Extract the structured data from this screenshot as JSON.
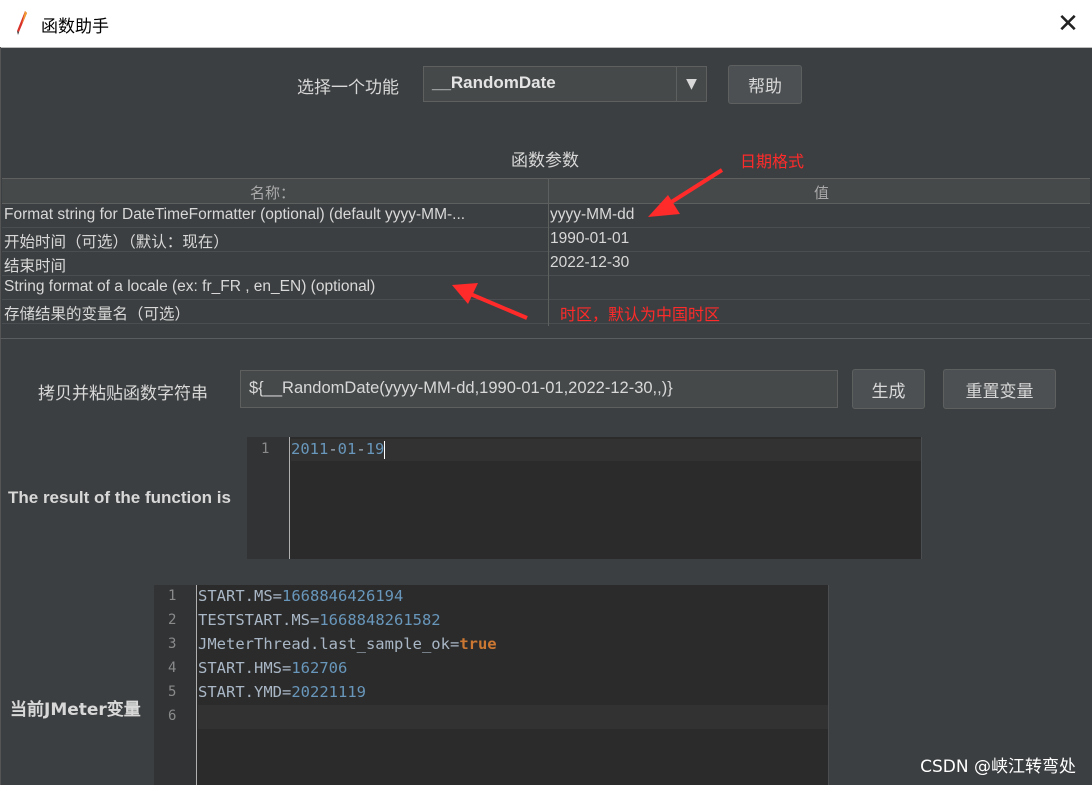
{
  "window": {
    "title": "函数助手",
    "close_glyph": "✕"
  },
  "function_select": {
    "label": "选择一个功能",
    "value": "__RandomDate",
    "arrow": "▼",
    "help_label": "帮助"
  },
  "params": {
    "section_title": "函数参数",
    "col_name": "名称：",
    "col_value": "值",
    "rows": [
      {
        "name": "Format string for DateTimeFormatter (optional) (default yyyy-MM-...",
        "value": "yyyy-MM-dd"
      },
      {
        "name": "开始时间（可选）（默认：现在）",
        "value": "1990-01-01"
      },
      {
        "name": "结束时间",
        "value": "2022-12-30"
      },
      {
        "name": "String format of a locale (ex: fr_FR , en_EN) (optional)",
        "value": ""
      },
      {
        "name": "存储结果的变量名（可选）",
        "value": ""
      }
    ]
  },
  "annotations": {
    "date_format": "日期格式",
    "timezone": "时区，默认为中国时区",
    "arrow_color": "#ff2a2a"
  },
  "copy_paste": {
    "label": "拷贝并粘贴函数字符串",
    "value": "${__RandomDate(yyyy-MM-dd,1990-01-01,2022-12-30,,)}",
    "generate_label": "生成",
    "reset_label": "重置变量"
  },
  "result": {
    "label": "The result of the function is",
    "line_numbers": [
      "1"
    ],
    "parts": [
      "2011",
      "-",
      "01",
      "-",
      "19"
    ]
  },
  "variables": {
    "label": "当前JMeter变量",
    "line_numbers": [
      "1",
      "2",
      "3",
      "4",
      "5",
      "6"
    ],
    "lines": [
      {
        "key": "START.MS",
        "eq": "=",
        "val": "1668846426194"
      },
      {
        "key": "TESTSTART.MS",
        "eq": "=",
        "val": "1668848261582"
      },
      {
        "key": "JMeterThread.last_sample_ok",
        "eq": "=",
        "val": "true"
      },
      {
        "key": "START.HMS",
        "eq": "=",
        "val": "162706"
      },
      {
        "key": "START.YMD",
        "eq": "=",
        "val": "20221119"
      }
    ]
  },
  "watermark": "CSDN @峡江转弯处",
  "colors": {
    "background": "#3c3f41",
    "editor_bg": "#2b2b2b",
    "number": "#6897bb",
    "keyword": "#cc7832"
  }
}
